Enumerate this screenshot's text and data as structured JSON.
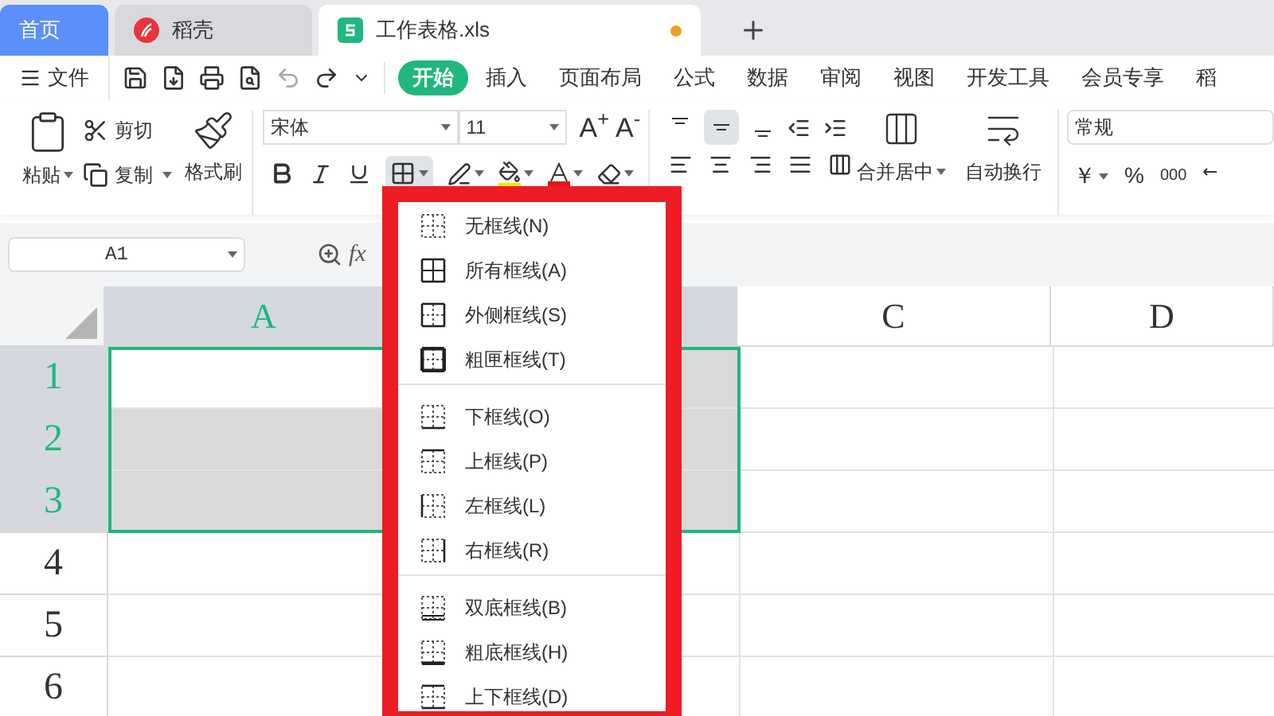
{
  "tabs": [
    {
      "label": "首页",
      "kind": "home",
      "selected": false
    },
    {
      "label": "稻壳",
      "kind": "docer",
      "selected": false
    },
    {
      "label": "工作表格.xls",
      "kind": "sheet",
      "selected": true,
      "unsaved": true
    }
  ],
  "menu_bar": {
    "file": "文件",
    "tabs": [
      {
        "label": "开始",
        "selected": true
      },
      {
        "label": "插入",
        "selected": false
      },
      {
        "label": "页面布局",
        "selected": false
      },
      {
        "label": "公式",
        "selected": false
      },
      {
        "label": "数据",
        "selected": false
      },
      {
        "label": "审阅",
        "selected": false
      },
      {
        "label": "视图",
        "selected": false
      },
      {
        "label": "开发工具",
        "selected": false
      },
      {
        "label": "会员专享",
        "selected": false
      },
      {
        "label": "稻",
        "selected": false
      }
    ]
  },
  "ribbon": {
    "paste": "粘贴",
    "cut": "剪切",
    "copy": "复制",
    "format_painter": "格式刷",
    "font_name": "宋体",
    "font_size": "11",
    "font_grow": "A$^{+}$",
    "font_shrink": "A$^{-}$",
    "border_button_pressed": true,
    "vertical_align": [
      {
        "kind": "top",
        "selected": false
      },
      {
        "kind": "middle",
        "selected": true
      },
      {
        "kind": "bottom",
        "selected": false
      }
    ],
    "merge": "合并居中",
    "wrap": "自动换行",
    "number_format": "常规",
    "currency": "￥",
    "percent": "%",
    "thousands": "000"
  },
  "name_box": "A1",
  "function_label": "fx",
  "sheet": {
    "columns": [
      {
        "label": "A",
        "selected": true
      },
      {
        "selected": true
      },
      {
        "label": "C",
        "selected": false
      },
      {
        "label": "D",
        "selected": false
      }
    ],
    "rows": [
      {
        "label": "1",
        "selected": true,
        "cells": [
          {
            "shaded": false
          },
          {
            "shaded": true
          }
        ]
      },
      {
        "label": "2",
        "selected": true,
        "cells": [
          {
            "shaded": true
          },
          {
            "shaded": true
          }
        ]
      },
      {
        "label": "3",
        "selected": true,
        "cells": [
          {
            "shaded": true
          },
          {
            "shaded": true
          }
        ]
      },
      {
        "label": "4",
        "selected": false
      },
      {
        "label": "5",
        "selected": false
      },
      {
        "label": "6",
        "selected": false
      }
    ]
  },
  "border_menu": {
    "sections": [
      [
        {
          "label": "无框线(N)",
          "kind": "none"
        },
        {
          "label": "所有框线(A)",
          "kind": "all"
        },
        {
          "label": "外侧框线(S)",
          "kind": "outside"
        },
        {
          "label": "粗匣框线(T)",
          "kind": "thick_box"
        }
      ],
      [
        {
          "label": "下框线(O)",
          "kind": "bottom"
        },
        {
          "label": "上框线(P)",
          "kind": "top"
        },
        {
          "label": "左框线(L)",
          "kind": "left"
        },
        {
          "label": "右框线(R)",
          "kind": "right"
        }
      ],
      [
        {
          "label": "双底框线(B)",
          "kind": "double_bottom"
        },
        {
          "label": "粗底框线(H)",
          "kind": "thick_bottom"
        },
        {
          "label": "上下框线(D)",
          "kind": "top_bottom"
        }
      ]
    ]
  }
}
